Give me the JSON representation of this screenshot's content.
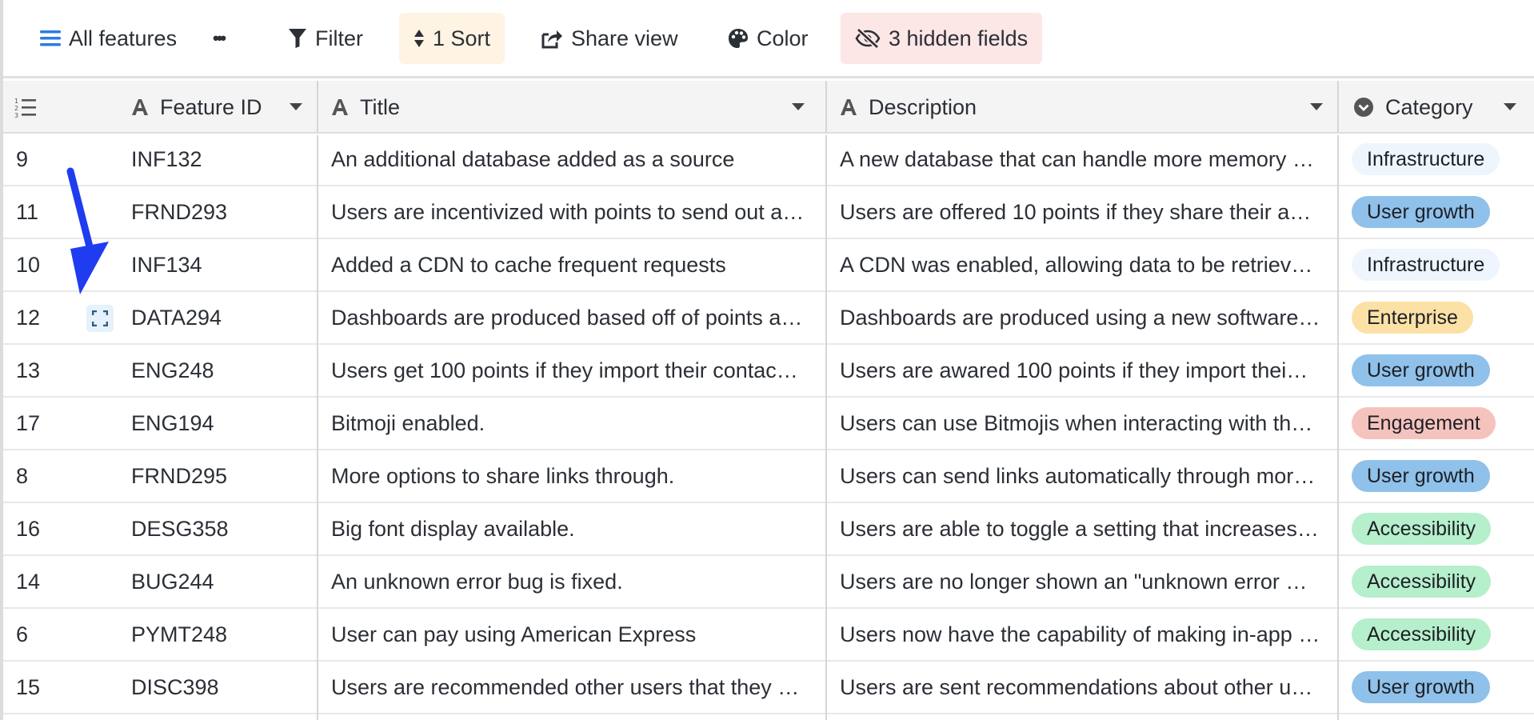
{
  "toolbar": {
    "view_name": "All features",
    "more_label": "•••",
    "filter_label": "Filter",
    "sort_label": "1 Sort",
    "share_label": "Share view",
    "color_label": "Color",
    "hidden_label": "3 hidden fields"
  },
  "columns": {
    "feature_id": "Feature ID",
    "title": "Title",
    "description": "Description",
    "category": "Category"
  },
  "category_colors": {
    "Infrastructure": "#eef5fc",
    "User growth": "#8fc1ea",
    "Enterprise": "#fbe1a5",
    "Engagement": "#f5c3bd",
    "Accessibility": "#b5efcb"
  },
  "rows": [
    {
      "num": "9",
      "id": "INF132",
      "title": "An additional database added as a source",
      "desc": "A new database that can handle more memory …",
      "category": "Infrastructure"
    },
    {
      "num": "11",
      "id": "FRND293",
      "title": "Users are incentivized with points to send out a…",
      "desc": "Users are offered 10 points if they share their a…",
      "category": "User growth"
    },
    {
      "num": "10",
      "id": "INF134",
      "title": "Added a CDN to cache frequent requests",
      "desc": "A CDN was enabled, allowing data to be retriev…",
      "category": "Infrastructure"
    },
    {
      "num": "12",
      "id": "DATA294",
      "title": "Dashboards are produced based off of points a…",
      "desc": "Dashboards are produced using a new software…",
      "category": "Enterprise"
    },
    {
      "num": "13",
      "id": "ENG248",
      "title": "Users get 100 points if they import their contac…",
      "desc": "Users are awared 100 points if they import thei…",
      "category": "User growth"
    },
    {
      "num": "17",
      "id": "ENG194",
      "title": "Bitmoji enabled.",
      "desc": "Users can use Bitmojis when interacting with th…",
      "category": "Engagement"
    },
    {
      "num": "8",
      "id": "FRND295",
      "title": "More options to share links through.",
      "desc": "Users can send links automatically through mor…",
      "category": "User growth"
    },
    {
      "num": "16",
      "id": "DESG358",
      "title": "Big font display available.",
      "desc": "Users are able to toggle a setting that increases …",
      "category": "Accessibility"
    },
    {
      "num": "14",
      "id": "BUG244",
      "title": "An unknown error bug is fixed.",
      "desc": "Users are no longer shown an \"unknown error …",
      "category": "Accessibility"
    },
    {
      "num": "6",
      "id": "PYMT248",
      "title": "User can pay using American Express",
      "desc": "Users now have the capability of making in-app …",
      "category": "Accessibility"
    },
    {
      "num": "15",
      "id": "DISC398",
      "title": "Users are recommended other users that they …",
      "desc": "Users are sent recommendations about other u…",
      "category": "User growth"
    }
  ],
  "annotation_color": "#1f3cf0"
}
